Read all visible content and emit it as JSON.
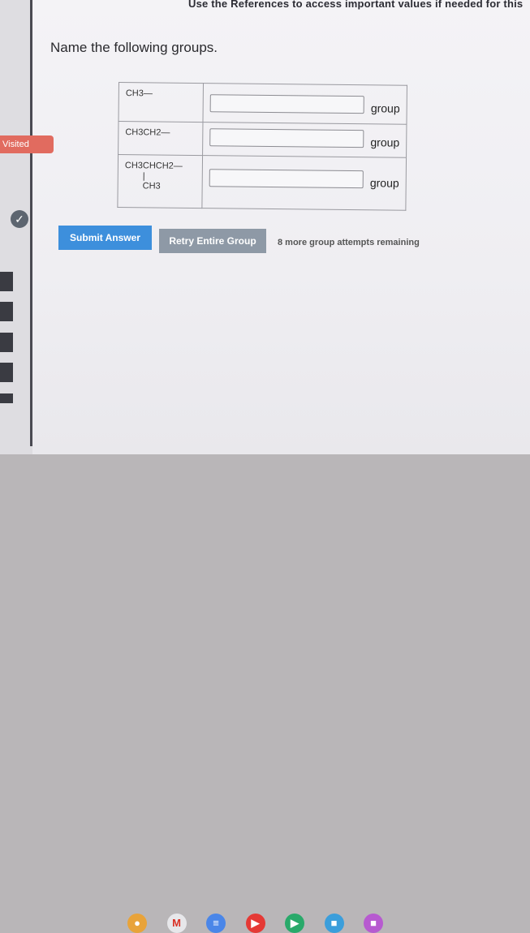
{
  "header": {
    "references_note": "Use the References to access important values if needed for this"
  },
  "sidebar": {
    "visited_label": "Visited",
    "back_glyph": "✓"
  },
  "question": {
    "instructions": "Name the following groups.",
    "rows": [
      {
        "formula": "CH3—",
        "unit": "group"
      },
      {
        "formula": "CH3CH2—",
        "unit": "group"
      },
      {
        "formula": "CH3CHCH2—",
        "branch": "CH3",
        "unit": "group"
      }
    ]
  },
  "actions": {
    "submit_label": "Submit Answer",
    "retry_label": "Retry Entire Group",
    "attempts_text": "8 more group attempts remaining"
  },
  "taskbar": {
    "icons": [
      {
        "name": "chrome-icon",
        "color": "#e8a33a",
        "glyph": "●"
      },
      {
        "name": "gmail-icon",
        "color": "#e7e7ea",
        "glyph": "M"
      },
      {
        "name": "docs-icon",
        "color": "#4a86e8",
        "glyph": "≡"
      },
      {
        "name": "youtube-icon",
        "color": "#e53935",
        "glyph": "▶"
      },
      {
        "name": "play-store-icon",
        "color": "#29a96a",
        "glyph": "▶"
      },
      {
        "name": "files-icon",
        "color": "#3b9edb",
        "glyph": "■"
      },
      {
        "name": "photos-icon",
        "color": "#b75ad0",
        "glyph": "■"
      }
    ]
  }
}
